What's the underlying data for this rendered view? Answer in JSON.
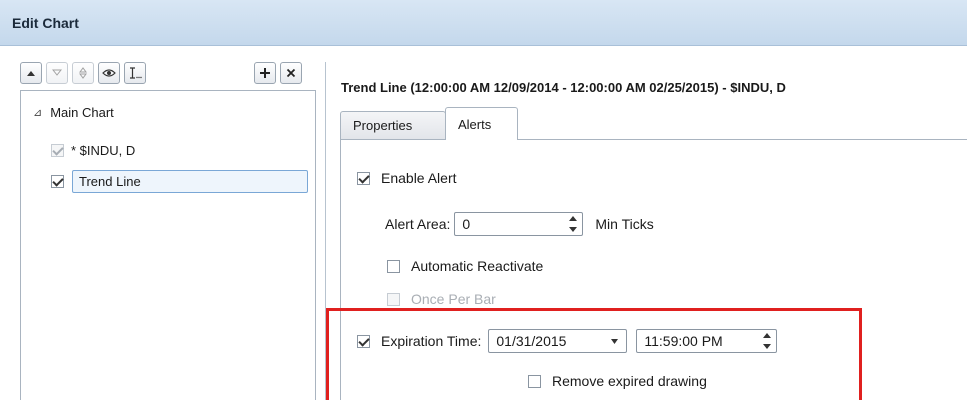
{
  "window": {
    "title": "Edit Chart"
  },
  "toolbar": {
    "icons": [
      "move-up-icon",
      "move-down-icon",
      "reorder-icon",
      "visibility-eye-icon",
      "text-format-icon",
      "add-icon",
      "remove-icon"
    ]
  },
  "tree": {
    "root": {
      "label": "Main Chart",
      "expander": "⊿"
    },
    "items": [
      {
        "label": "* $INDU, D",
        "checked": true,
        "disabled": true
      },
      {
        "label": "Trend Line",
        "checked": true,
        "disabled": false,
        "selected": true
      }
    ]
  },
  "detail": {
    "heading": "Trend Line (12:00:00 AM 12/09/2014 - 12:00:00 AM 02/25/2015) - $INDU, D",
    "tabs": [
      {
        "label": "Properties",
        "active": false
      },
      {
        "label": "Alerts",
        "active": true
      }
    ]
  },
  "alerts": {
    "enable_alert": {
      "label": "Enable Alert",
      "checked": true
    },
    "alert_area": {
      "label": "Alert Area:",
      "value": "0",
      "unit": "Min Ticks"
    },
    "automatic_reactivate": {
      "label": "Automatic Reactivate",
      "checked": false
    },
    "once_per_bar": {
      "label": "Once Per Bar",
      "checked": false,
      "disabled": true
    },
    "expiration_time": {
      "label": "Expiration Time:",
      "checked": true,
      "date": "01/31/2015",
      "time": "11:59:00 PM"
    },
    "remove_expired": {
      "label": "Remove expired drawing",
      "checked": false
    }
  },
  "colors": {
    "titlebar": "#c4d8ec",
    "highlight_box": "#e0201f",
    "selection_border": "#7aa7d6"
  }
}
